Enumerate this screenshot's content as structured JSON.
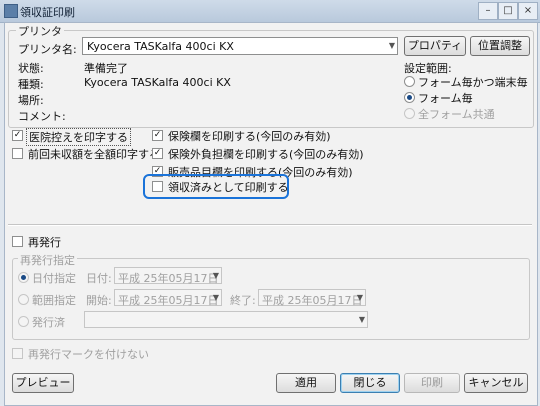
{
  "window": {
    "title": "領収証印刷"
  },
  "printer": {
    "group_label": "プリンタ",
    "name_label": "プリンタ名:",
    "name_value": "Kyocera TASKalfa 400ci KX",
    "properties_button": "プロパティ",
    "position_button": "位置調整",
    "status_label": "状態:",
    "status_value": "準備完了",
    "type_label": "種類:",
    "type_value": "Kyocera TASKalfa 400ci KX",
    "location_label": "場所:",
    "comment_label": "コメント:"
  },
  "scope": {
    "label": "設定範囲:",
    "options": [
      {
        "label": "フォーム毎かつ端末毎",
        "selected": false,
        "enabled": true
      },
      {
        "label": "フォーム毎",
        "selected": true,
        "enabled": true
      },
      {
        "label": "全フォーム共通",
        "selected": false,
        "enabled": false
      }
    ]
  },
  "options_left": [
    {
      "label": "医院控えを印字する",
      "checked": true
    },
    {
      "label": "前回未収額を全額印字する",
      "checked": false
    }
  ],
  "options_right": [
    {
      "label": "保険欄を印刷する(今回のみ有効)",
      "checked": true
    },
    {
      "label": "保険外負担欄を印刷する(今回のみ有効)",
      "checked": true
    },
    {
      "label": "販売品目欄を印刷する(今回のみ有効)",
      "checked": true
    },
    {
      "label": "領収済みとして印刷する",
      "checked": false,
      "highlighted": true
    }
  ],
  "reissue": {
    "checkbox_label": "再発行",
    "checked": false,
    "group_label": "再発行指定",
    "date_option": "日付指定",
    "date_label": "日付:",
    "date_value": "平成 25年05月17日",
    "range_option": "範囲指定",
    "start_label": "開始:",
    "start_value": "平成 25年05月17日",
    "end_label": "終了:",
    "end_value": "平成 25年05月17日",
    "issued_option": "発行済",
    "issued_value": "",
    "mark_label": "再発行マークを付けない"
  },
  "buttons": {
    "preview": "プレビュー",
    "apply": "適用",
    "close": "閉じる",
    "print": "印刷",
    "cancel": "キャンセル"
  },
  "colors": {
    "highlight": "#1a73d9",
    "window_frame": "#b9c9dc"
  }
}
